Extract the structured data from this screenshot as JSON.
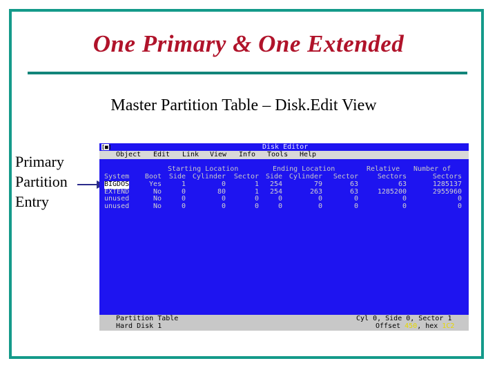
{
  "slide": {
    "title": "One Primary & One Extended",
    "subtitle": "Master Partition Table – Disk.Edit View",
    "side_label_lines": [
      "Primary",
      "Partition",
      "Entry"
    ]
  },
  "colors": {
    "title": "#b0132a",
    "frame": "#149a8a",
    "screen": "#1e14f0"
  },
  "editor": {
    "sysbox": "[■]",
    "title": "Disk Editor",
    "menu": [
      "Object",
      "Edit",
      "Link",
      "View",
      "Info",
      "Tools",
      "Help"
    ],
    "group_headers": {
      "start": "Starting Location",
      "end": "Ending Location",
      "relative": "Relative",
      "number": "Number of"
    },
    "columns": [
      "System",
      "Boot",
      "Side",
      "Cylinder",
      "Sector",
      "Side",
      "Cylinder",
      "Sector",
      "Sectors",
      "Sectors"
    ],
    "rows": [
      [
        "BIGDOS",
        "Yes",
        "1",
        "0",
        "1",
        "254",
        "79",
        "63",
        "63",
        "1285137"
      ],
      [
        "EXTEND",
        "No",
        "0",
        "80",
        "1",
        "254",
        "263",
        "63",
        "1285200",
        "2955960"
      ],
      [
        "unused",
        "No",
        "0",
        "0",
        "0",
        "0",
        "0",
        "0",
        "0",
        "0"
      ],
      [
        "unused",
        "No",
        "0",
        "0",
        "0",
        "0",
        "0",
        "0",
        "0",
        "0"
      ]
    ],
    "status": {
      "left1": "Partition Table",
      "left2": "Hard Disk 1",
      "right1": "Cyl 0, Side 0, Sector 1",
      "offset_label": "Offset",
      "offset_value": "450",
      "hex_label": "hex",
      "hex_value": "1C2"
    }
  }
}
